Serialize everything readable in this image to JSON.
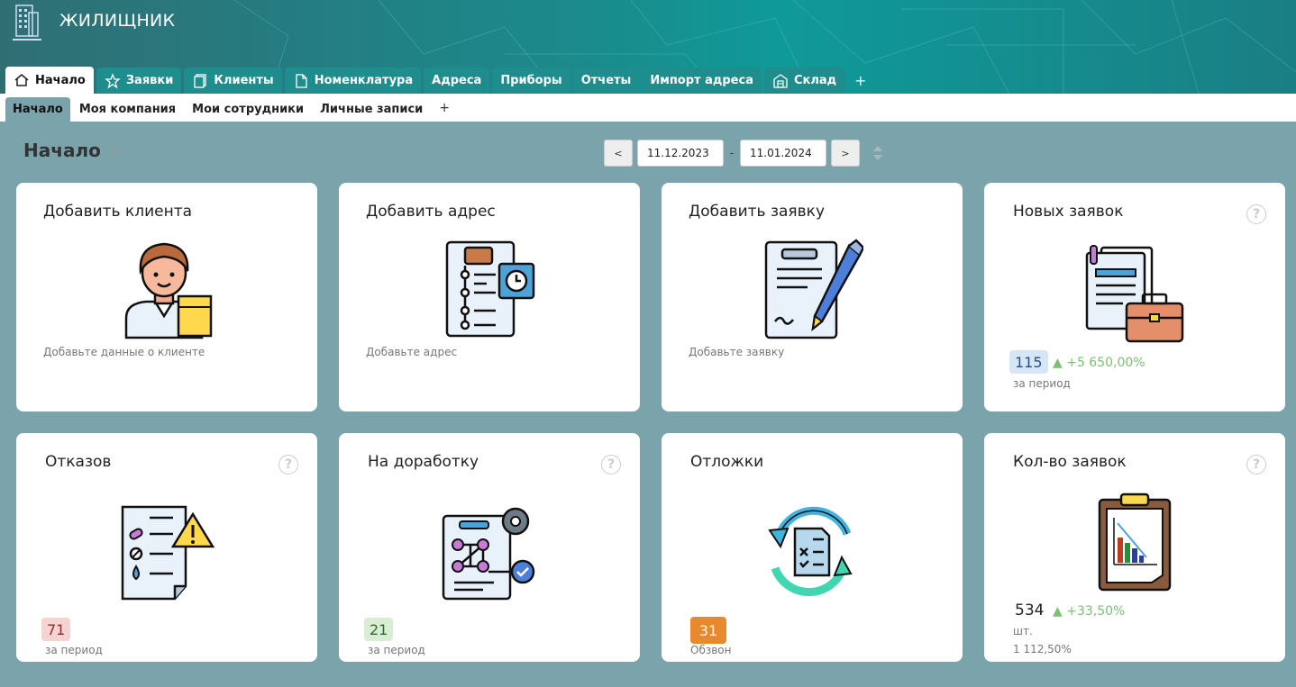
{
  "app": {
    "title": "ЖИЛИЩНИК"
  },
  "tabs": [
    {
      "label": "Начало",
      "icon": "home-icon",
      "active": true
    },
    {
      "label": "Заявки",
      "icon": "star-icon"
    },
    {
      "label": "Клиенты",
      "icon": "copy-icon"
    },
    {
      "label": "Номенклатура",
      "icon": "file-icon"
    },
    {
      "label": "Адреса"
    },
    {
      "label": "Приборы"
    },
    {
      "label": "Отчеты"
    },
    {
      "label": "Импорт адреса"
    },
    {
      "label": "Склад",
      "icon": "warehouse-icon"
    }
  ],
  "tab_add": "+",
  "subtabs": [
    {
      "label": "Начало",
      "active": true
    },
    {
      "label": "Моя компания"
    },
    {
      "label": "Мои сотрудники"
    },
    {
      "label": "Личные записи"
    }
  ],
  "subtab_add": "+",
  "page": {
    "title": "Начало"
  },
  "period": {
    "prev": "<",
    "next": ">",
    "from": "11.12.2023",
    "to": "11.01.2024",
    "separator": "-"
  },
  "cards": {
    "add_client": {
      "title": "Добавить клиента",
      "subtitle": "Добавьте данные о клиенте"
    },
    "add_address": {
      "title": "Добавить адрес",
      "subtitle": "Добавьте адрес"
    },
    "add_request": {
      "title": "Добавить заявку",
      "subtitle": "Добавьте заявку"
    },
    "new_requests": {
      "title": "Новых заявок",
      "value": "115",
      "delta": "▲ +5 650,00%",
      "note": "за период"
    },
    "refusals": {
      "title": "Отказов",
      "value": "71",
      "note": "за период"
    },
    "rework": {
      "title": "На доработку",
      "value": "21",
      "note": "за период"
    },
    "postponed": {
      "title": "Отложки",
      "value": "31",
      "note": "Обзвон"
    },
    "count": {
      "title": "Кол-во заявок",
      "value": "534",
      "delta": "▲ +33,50%",
      "unit": "шт.",
      "note": "1 112,50%"
    }
  },
  "help_glyph": "?",
  "colors": {
    "accent": "#1f8c8d",
    "background": "#7aa3ab",
    "badge_blue": "#d6e6f7",
    "badge_red": "#f6d3d3",
    "badge_green": "#d9ecd4",
    "badge_orange": "#e8892d",
    "delta_green": "#7cbf75"
  }
}
